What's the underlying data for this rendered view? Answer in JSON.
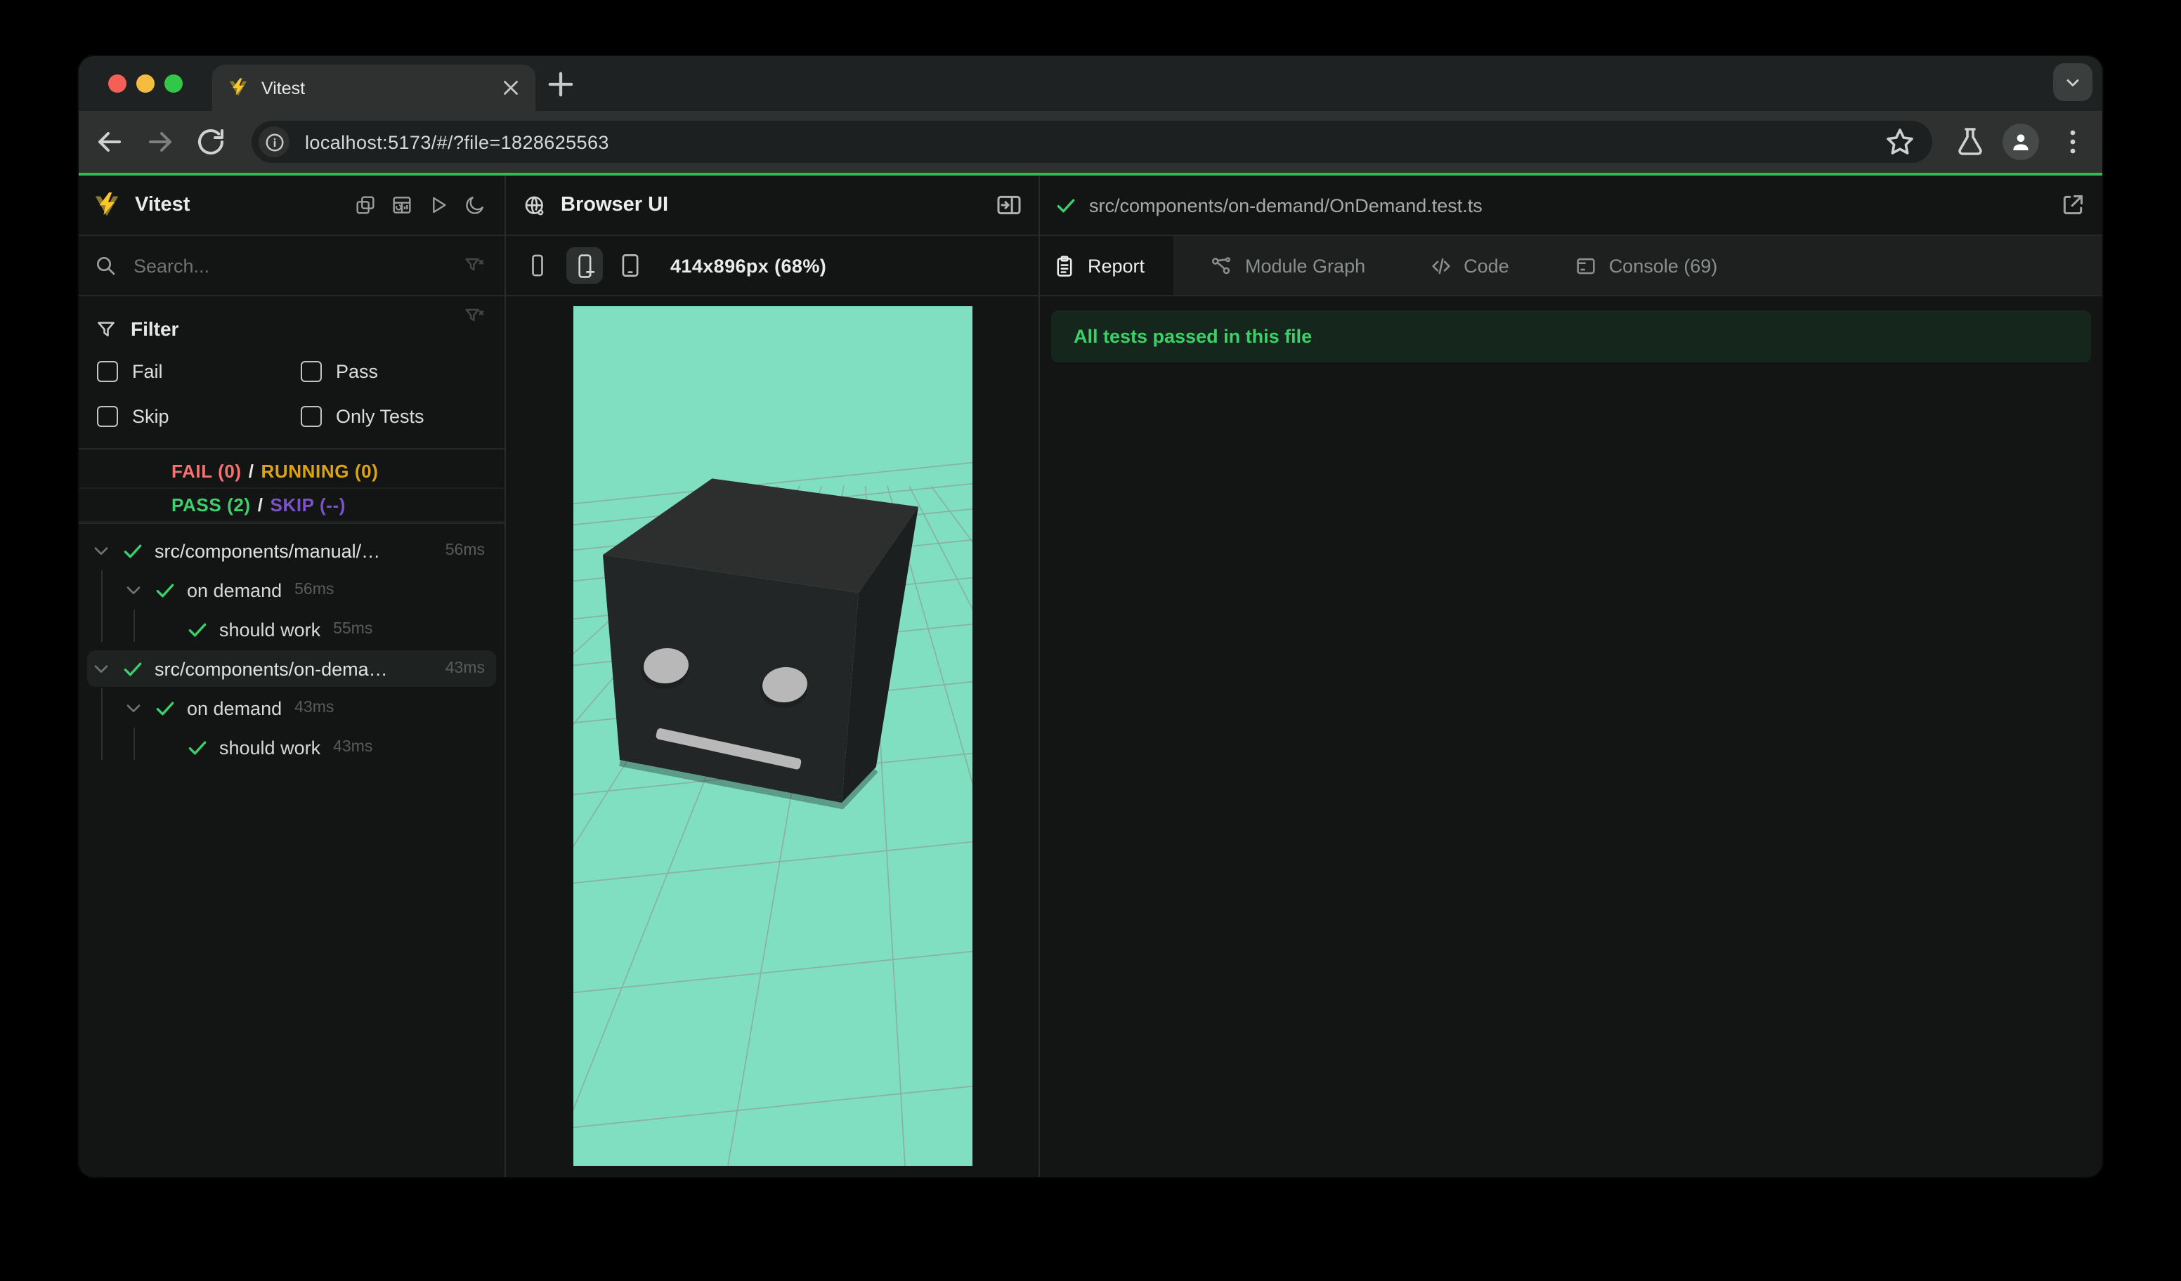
{
  "browser": {
    "tab_title": "Vitest",
    "url": "localhost:5173/#/?file=1828625563"
  },
  "sidebar": {
    "app_title": "Vitest",
    "search_placeholder": "Search...",
    "filter": {
      "label": "Filter",
      "options": [
        {
          "label": "Fail",
          "checked": false
        },
        {
          "label": "Pass",
          "checked": false
        },
        {
          "label": "Skip",
          "checked": false
        },
        {
          "label": "Only Tests",
          "checked": false
        }
      ]
    },
    "stats": {
      "fail": "FAIL (0)",
      "running": "RUNNING (0)",
      "pass": "PASS (2)",
      "skip": "SKIP (--)",
      "separator": "/"
    },
    "tree": {
      "rows": [
        {
          "type": "file",
          "label": "src/components/manual/…",
          "duration": "56ms",
          "status": "pass",
          "selected": false
        },
        {
          "type": "suite",
          "label": "on demand",
          "duration": "56ms",
          "status": "pass",
          "selected": false
        },
        {
          "type": "test",
          "label": "should work",
          "duration": "55ms",
          "status": "pass",
          "selected": false
        },
        {
          "type": "file",
          "label": "src/components/on-dema…",
          "duration": "43ms",
          "status": "pass",
          "selected": true
        },
        {
          "type": "suite",
          "label": "on demand",
          "duration": "43ms",
          "status": "pass",
          "selected": false
        },
        {
          "type": "test",
          "label": "should work",
          "duration": "43ms",
          "status": "pass",
          "selected": false
        }
      ]
    }
  },
  "preview": {
    "title": "Browser UI",
    "viewport_label": "414x896px (68%)"
  },
  "details": {
    "file_path": "src/components/on-demand/OnDemand.test.ts",
    "tabs": [
      {
        "label": "Report",
        "active": true
      },
      {
        "label": "Module Graph",
        "active": false
      },
      {
        "label": "Code",
        "active": false
      },
      {
        "label": "Console (69)",
        "active": false
      }
    ],
    "banner": "All tests passed in this file"
  },
  "icons": {
    "sidebar_header": [
      "windows-restore-icon",
      "dashboard-report-icon",
      "run-all-play-icon",
      "dark-mode-moon-icon"
    ],
    "device_toolbar": [
      "phone-small-icon",
      "phone-plus-icon",
      "tablet-icon"
    ],
    "detail_tabs": [
      "report-clipboard-icon",
      "module-graph-icon",
      "code-icon",
      "console-icon"
    ]
  },
  "colors": {
    "accent_green": "#2abd58",
    "check_green": "#3ccf6e",
    "mint_background": "#80dec1",
    "fail_red": "#f87171",
    "running_yellow": "#dca313",
    "pass_green": "#3ed06c",
    "skip_purple": "#7c52c8",
    "banner_bg": "#15271c",
    "banner_text": "#3dd069"
  }
}
